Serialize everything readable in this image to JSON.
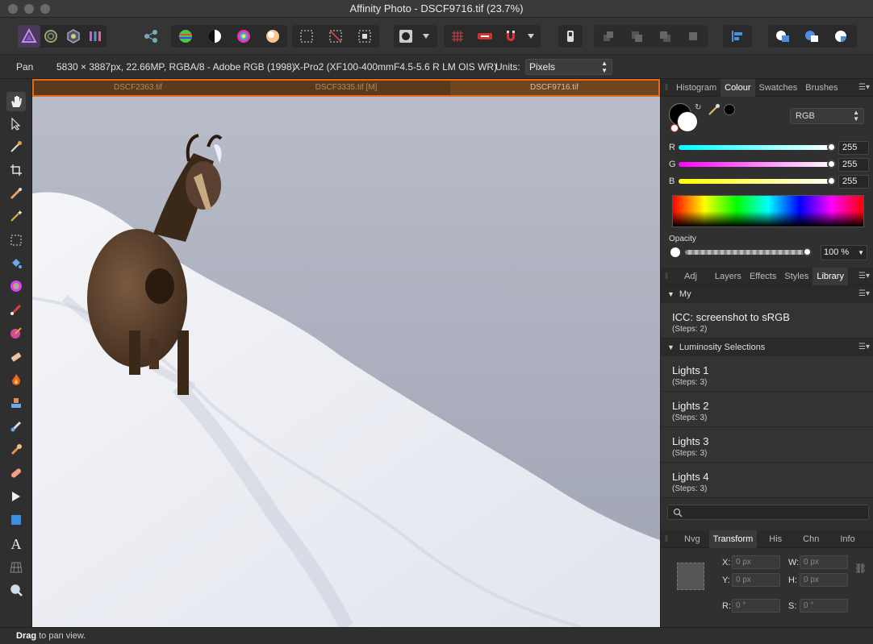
{
  "window": {
    "title": "Affinity Photo - DSCF9716.tif (23.7%)"
  },
  "context": {
    "tool": "Pan",
    "doc_info": "5830 × 3887px, 22.66MP, RGBA/8 - Adobe RGB (1998)",
    "camera": "X-Pro2 (XF100-400mmF4.5-5.6 R LM OIS WR)",
    "units_label": "Units:",
    "units_value": "Pixels"
  },
  "doc_tabs": [
    {
      "label": "DSCF2363.tif"
    },
    {
      "label": "DSCF3335.tif [M]"
    },
    {
      "label": "DSCF9716.tif"
    }
  ],
  "colour_panel": {
    "tabs": [
      "Histogram",
      "Colour",
      "Swatches",
      "Brushes"
    ],
    "active_tab": "Colour",
    "model": "RGB",
    "channels": [
      {
        "label": "R",
        "value": "255"
      },
      {
        "label": "G",
        "value": "255"
      },
      {
        "label": "B",
        "value": "255"
      }
    ],
    "opacity_label": "Opacity",
    "opacity_value": "100 %"
  },
  "library_panel": {
    "tabs": [
      "Adj",
      "Layers",
      "Effects",
      "Styles",
      "Library"
    ],
    "active_tab": "Library",
    "sections": [
      {
        "name": "My",
        "items": [
          {
            "title": "ICC: screenshot to sRGB",
            "steps": "(Steps: 2)"
          }
        ]
      },
      {
        "name": "Luminosity Selections",
        "items": [
          {
            "title": "Lights 1",
            "steps": "(Steps: 3)"
          },
          {
            "title": "Lights 2",
            "steps": "(Steps: 3)"
          },
          {
            "title": "Lights 3",
            "steps": "(Steps: 3)"
          },
          {
            "title": "Lights 4",
            "steps": "(Steps: 3)"
          }
        ]
      }
    ]
  },
  "transform_panel": {
    "tabs": [
      "Nvg",
      "Transform",
      "His",
      "Chn",
      "Info"
    ],
    "active_tab": "Transform",
    "x_label": "X:",
    "x_value": "0 px",
    "y_label": "Y:",
    "y_value": "0 px",
    "w_label": "W:",
    "w_value": "0 px",
    "h_label": "H:",
    "h_value": "0 px",
    "r_label": "R:",
    "r_value": "0 °",
    "s_label": "S:",
    "s_value": "0 °"
  },
  "status": {
    "bold": "Drag",
    "text": " to pan view."
  }
}
